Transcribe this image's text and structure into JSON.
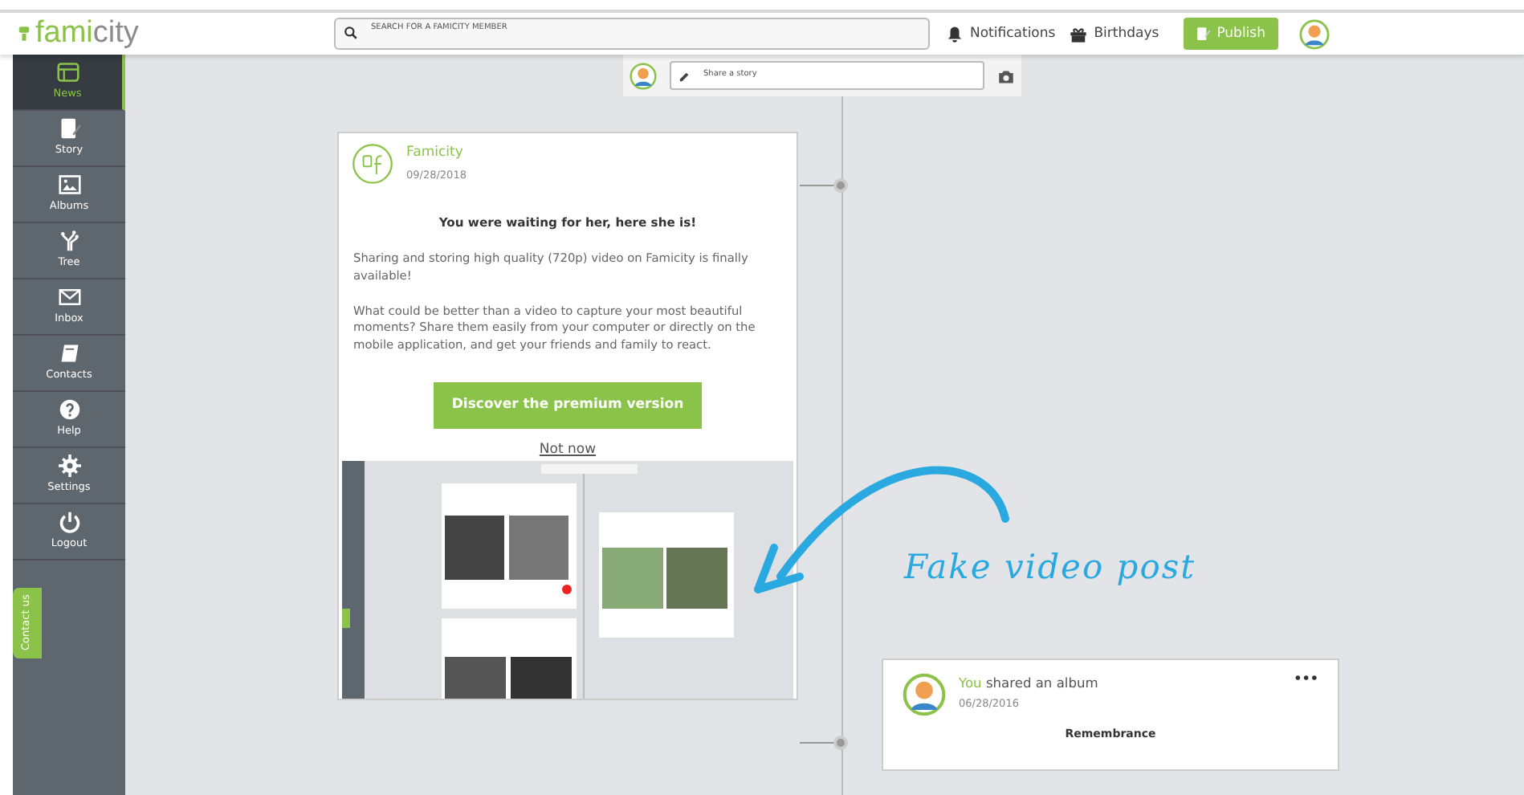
{
  "header": {
    "logo": [
      "fami",
      "city"
    ],
    "search": {
      "placeholder": "SEARCH FOR A FAMICITY MEMBER"
    },
    "links": [
      "Notifications",
      "Birthdays"
    ],
    "publish": "Publish"
  },
  "sidebar": {
    "items": [
      {
        "label": "News",
        "selected": true
      },
      {
        "label": "Story",
        "selected": false
      },
      {
        "label": "Albums",
        "selected": false
      },
      {
        "label": "Tree",
        "selected": false
      },
      {
        "label": "Inbox",
        "selected": false
      },
      {
        "label": "Contacts",
        "selected": false
      },
      {
        "label": "Help",
        "selected": false
      },
      {
        "label": "Settings",
        "selected": false
      },
      {
        "label": "Logout",
        "selected": false
      }
    ],
    "contact_tab": "Contact us"
  },
  "share_bar": {
    "placeholder": "Share a story"
  },
  "popup": {
    "author": "Famicity",
    "date": "09/28/2018",
    "heading": "You were waiting for her, here she is!",
    "paragraphs": [
      "Sharing and storing high quality (720p) video on Famicity is finally available!",
      "What could be better than a video to capture your most beautiful moments? Share them easily from your computer or directly on the mobile application, and get your friends and family to react."
    ],
    "primary_button": "Discover the premium version",
    "secondary_link": "Not now"
  },
  "annotation": {
    "text": "Fake video post"
  },
  "post": {
    "author": "You",
    "action": "shared an album",
    "date": "06/28/2016",
    "menu": "•••",
    "album_title": "Remembrance"
  }
}
